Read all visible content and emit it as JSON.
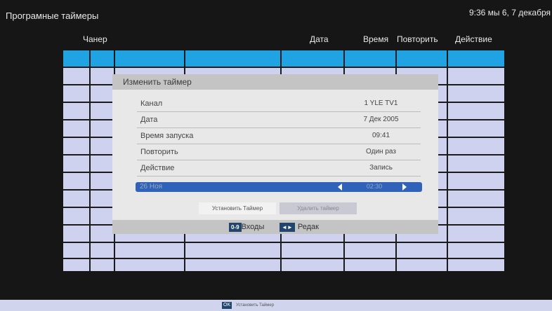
{
  "header": {
    "title": "Програмные таймеры",
    "clock": "9:36 мы 6, 7 декабря"
  },
  "table": {
    "columns": [
      "Чанер",
      "Дата",
      "Время",
      "Повторить",
      "Действие"
    ]
  },
  "dialog": {
    "title": "Изменить таймер",
    "fields": [
      {
        "label": "Канал",
        "value": "1 YLE TV1"
      },
      {
        "label": "Дата",
        "value": "7 Дек 2005"
      },
      {
        "label": "Время запуска",
        "value": "09:41"
      },
      {
        "label": "Повторить",
        "value": "Один раз"
      },
      {
        "label": "Действие",
        "value": "Запись"
      }
    ],
    "selected": {
      "label": "26 Ноя",
      "value": "02:30"
    },
    "buttons": {
      "set": "Установить Таймер",
      "delete": "Удалить таймер"
    },
    "footer": {
      "key1": "0-9",
      "label1": "Входы",
      "key2": "◄►",
      "label2": "Редак"
    }
  },
  "bottom": {
    "key": "OK",
    "text": "Установить Таймер"
  },
  "colors": {
    "highlight": "#1fa3e3",
    "grid": "#cfd2ee",
    "accent": "#22456e",
    "slider": "#2f62b8"
  }
}
